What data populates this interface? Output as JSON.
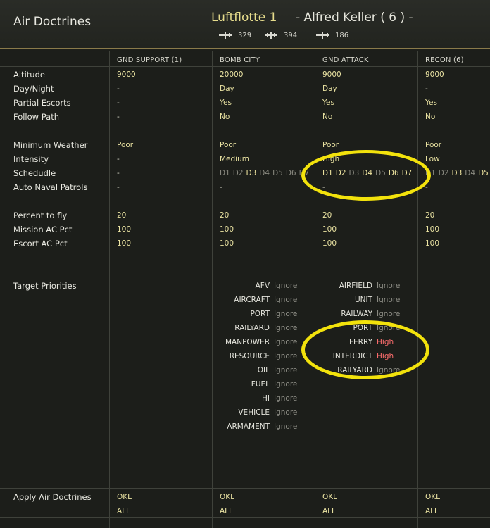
{
  "header": {
    "title": "Air Doctrines",
    "fleet": "Luftflotte 1",
    "commander": "- Alfred Keller ( 6 ) -",
    "counts": [
      {
        "icon": "fighter-plane-icon",
        "value": "329"
      },
      {
        "icon": "bomber-plane-icon",
        "value": "394"
      },
      {
        "icon": "transport-plane-icon",
        "value": "186"
      }
    ]
  },
  "columns": [
    "GND SUPPORT (1)",
    "BOMB CITY",
    "GND ATTACK",
    "RECON (6)"
  ],
  "rows": {
    "altitude": {
      "label": "Altitude",
      "values": [
        "9000",
        "20000",
        "9000",
        "9000"
      ]
    },
    "day_night": {
      "label": "Day/Night",
      "values": [
        "-",
        "Day",
        "Day",
        "-"
      ]
    },
    "partial_escorts": {
      "label": "Partial Escorts",
      "values": [
        "-",
        "Yes",
        "Yes",
        "Yes"
      ]
    },
    "follow_path": {
      "label": "Follow Path",
      "values": [
        "-",
        "No",
        "No",
        "No"
      ]
    },
    "min_weather": {
      "label": "Minimum Weather",
      "values": [
        "Poor",
        "Poor",
        "Poor",
        "Poor"
      ]
    },
    "intensity": {
      "label": "Intensity",
      "values": [
        "-",
        "Medium",
        "High",
        "Low"
      ]
    },
    "schedule": {
      "label": "Schedudle",
      "values": [
        "-"
      ]
    },
    "auto_naval": {
      "label": "Auto Naval Patrols",
      "values": [
        "-",
        "-",
        "-",
        "-"
      ]
    },
    "percent_fly": {
      "label": "Percent to fly",
      "values": [
        "20",
        "20",
        "20",
        "20"
      ]
    },
    "mission_ac": {
      "label": "Mission AC Pct",
      "values": [
        "100",
        "100",
        "100",
        "100"
      ]
    },
    "escort_ac": {
      "label": "Escort AC Pct",
      "values": [
        "100",
        "100",
        "100",
        "100"
      ]
    }
  },
  "schedule_days": {
    "bomb_city": [
      {
        "d": "D1",
        "on": false
      },
      {
        "d": "D2",
        "on": false
      },
      {
        "d": "D3",
        "on": true
      },
      {
        "d": "D4",
        "on": false
      },
      {
        "d": "D5",
        "on": false
      },
      {
        "d": "D6",
        "on": false
      },
      {
        "d": "D7",
        "on": false
      }
    ],
    "gnd_attack": [
      {
        "d": "D1",
        "on": true
      },
      {
        "d": "D2",
        "on": true
      },
      {
        "d": "D3",
        "on": false
      },
      {
        "d": "D4",
        "on": true
      },
      {
        "d": "D5",
        "on": false
      },
      {
        "d": "D6",
        "on": true
      },
      {
        "d": "D7",
        "on": true
      }
    ],
    "recon": [
      {
        "d": "D1",
        "on": false
      },
      {
        "d": "D2",
        "on": false
      },
      {
        "d": "D3",
        "on": true
      },
      {
        "d": "D4",
        "on": false
      },
      {
        "d": "D5",
        "on": true
      }
    ]
  },
  "target_priorities": {
    "label": "Target Priorities",
    "bomb_city": [
      {
        "name": "AFV",
        "level": "Ignore"
      },
      {
        "name": "AIRCRAFT",
        "level": "Ignore"
      },
      {
        "name": "PORT",
        "level": "Ignore"
      },
      {
        "name": "RAILYARD",
        "level": "Ignore"
      },
      {
        "name": "MANPOWER",
        "level": "Ignore"
      },
      {
        "name": "RESOURCE",
        "level": "Ignore"
      },
      {
        "name": "OIL",
        "level": "Ignore"
      },
      {
        "name": "FUEL",
        "level": "Ignore"
      },
      {
        "name": "HI",
        "level": "Ignore"
      },
      {
        "name": "VEHICLE",
        "level": "Ignore"
      },
      {
        "name": "ARMAMENT",
        "level": "Ignore"
      }
    ],
    "gnd_attack": [
      {
        "name": "AIRFIELD",
        "level": "Ignore"
      },
      {
        "name": "UNIT",
        "level": "Ignore"
      },
      {
        "name": "RAILWAY",
        "level": "Ignore"
      },
      {
        "name": "PORT",
        "level": "Ignore"
      },
      {
        "name": "FERRY",
        "level": "High"
      },
      {
        "name": "INTERDICT",
        "level": "High"
      },
      {
        "name": "RAILYARD",
        "level": "Ignore"
      }
    ]
  },
  "apply": {
    "label": "Apply Air Doctrines",
    "okl": "OKL",
    "all": "ALL"
  },
  "colors": {
    "highlight_circle": "#f2e20c",
    "value_text": "#eae3a2",
    "high_priority": "#ff6e6e",
    "ignore_priority": "#8e8e86"
  }
}
